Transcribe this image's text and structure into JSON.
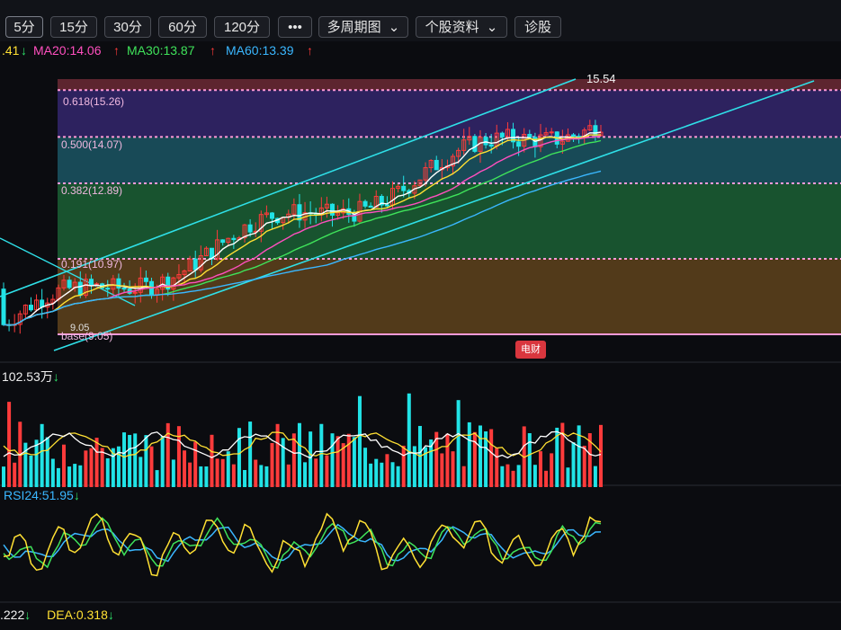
{
  "toolbar": {
    "periods": [
      "5分",
      "15分",
      "30分",
      "60分",
      "120分"
    ],
    "more": "•••",
    "multi_period": "多周期图",
    "stock_info": "个股资料",
    "diagnose": "诊股",
    "dropdown_arrow": "⌄"
  },
  "ma_row": {
    "ma10_partial": ".41",
    "ma10_arrow": "↓",
    "ma20": "MA20:14.06",
    "ma20_arrow": "↑",
    "ma30": "MA30:13.87",
    "ma30_arrow": "↑",
    "ma60": "MA60:13.39",
    "ma60_arrow": "↑",
    "colors": {
      "ma10": "#ffe033",
      "ma20": "#ff4fbf",
      "ma30": "#3fe35a",
      "ma60": "#3ab7ff"
    }
  },
  "fib_levels": [
    {
      "label": "0.618(15.26)",
      "value": 15.26
    },
    {
      "label": "0.500(14.07)",
      "value": 14.07
    },
    {
      "label": "0.382(12.89)",
      "value": 12.89
    },
    {
      "label": "0.191(10.97)",
      "value": 10.97
    },
    {
      "label": "base(9.05)",
      "value": 9.05
    }
  ],
  "price_annotations": {
    "high": "15.54",
    "low": "9.05"
  },
  "event_badge": "电财",
  "volume": {
    "label": "102.53万",
    "arrow": "↓"
  },
  "rsi": {
    "label": "RSI24:51.95",
    "arrow": "↓"
  },
  "macd": {
    "diff_partial": ".222",
    "diff_arrow": "↓",
    "dea": "DEA:0.318",
    "dea_arrow": "↓"
  },
  "colors": {
    "up": "#ff3b3b",
    "down": "#21e3e6",
    "fib_line": "#ff9ad8",
    "channel": "#2fe0e8"
  }
}
